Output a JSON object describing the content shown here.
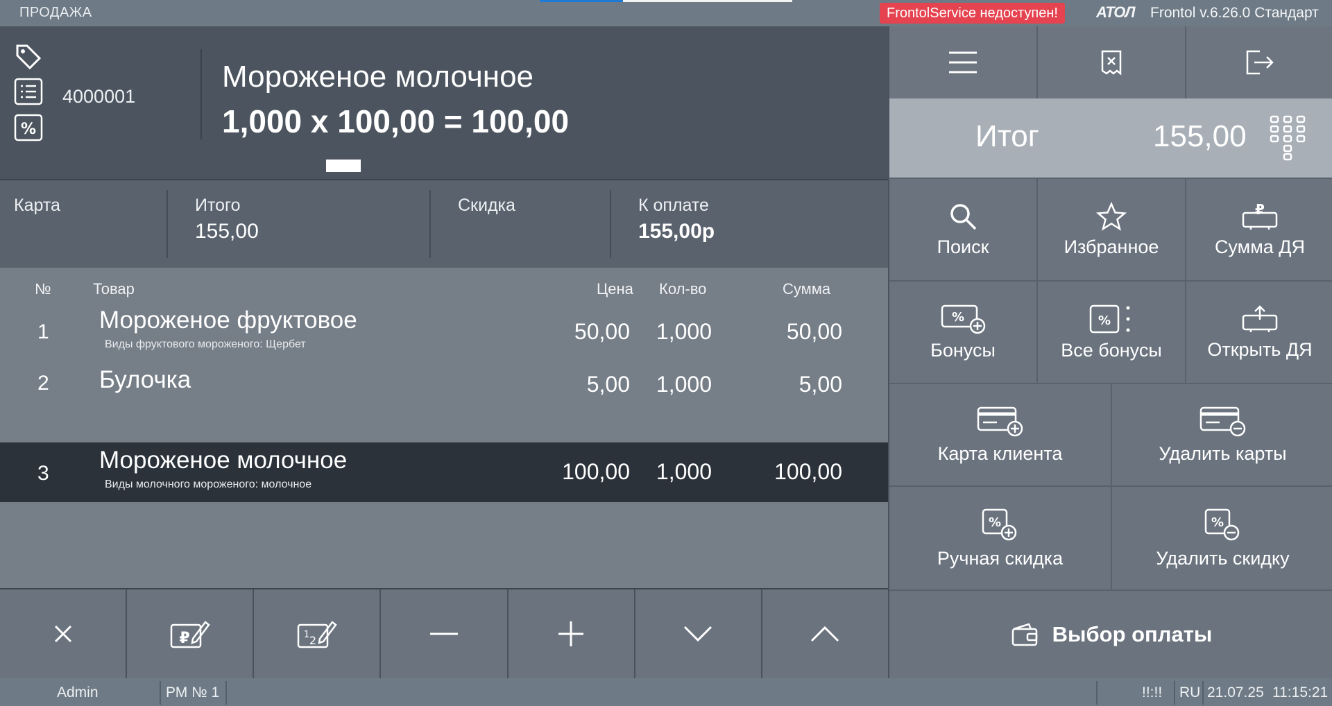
{
  "topbar": {
    "mode": "ПРОДАЖА",
    "progress": 0.33,
    "service_status": "FrontolService недоступен!",
    "brand": "ATOЛ",
    "version": "Frontol v.6.26.0 Стандарт"
  },
  "item_header": {
    "code": "4000001",
    "name": "Мороженое молочное",
    "formula": "1,000 x 100,00 = 100,00",
    "icons": [
      "tag-icon",
      "list-icon",
      "percent-icon"
    ]
  },
  "totals": {
    "card_label": "Карта",
    "card_value": "",
    "itogo_label": "Итого",
    "itogo_value": "155,00",
    "discount_label": "Скидка",
    "discount_value": "",
    "to_pay_label": "К оплате",
    "to_pay_value": "155,00р"
  },
  "table": {
    "headers": {
      "num": "№",
      "name": "Товар",
      "price": "Цена",
      "qty": "Кол-во",
      "sum": "Сумма"
    },
    "rows": [
      {
        "num": "1",
        "name": "Мороженое фруктовое",
        "sub": "Виды фруктового мороженого: Щербет",
        "price": "50,00",
        "qty": "1,000",
        "sum": "50,00"
      },
      {
        "num": "2",
        "name": "Булочка",
        "sub": "",
        "price": "5,00",
        "qty": "1,000",
        "sum": "5,00"
      },
      {
        "num": "3",
        "name": "Мороженое молочное",
        "sub": "Виды молочного мороженого: молочное",
        "price": "100,00",
        "qty": "1,000",
        "sum": "100,00"
      }
    ],
    "selected_row": 3
  },
  "bottom_buttons": [
    "close-icon",
    "edit-price-icon",
    "edit-quantity-icon",
    "minus-icon",
    "plus-icon",
    "chevron-down-icon",
    "chevron-up-icon"
  ],
  "right": {
    "top_buttons": [
      "menu-icon",
      "cancel-receipt-icon",
      "logout-icon"
    ],
    "total_label": "Итог",
    "total_value": "155,00",
    "actions": {
      "search": "Поиск",
      "favorites": "Избранное",
      "sum_dya": "Сумма ДЯ",
      "bonuses": "Бонусы",
      "all_bonuses": "Все бонусы",
      "open_dya": "Открыть ДЯ",
      "client_card": "Карта клиента",
      "delete_cards": "Удалить карты",
      "manual_discount": "Ручная скидка",
      "delete_discount": "Удалить скидку",
      "payment": "Выбор оплаты"
    }
  },
  "statusbar": {
    "user": "Admin",
    "workplace": "РМ № 1",
    "indicator": "!!:!!",
    "lang": "RU",
    "date": "21.07.25",
    "time": "11:15:21"
  },
  "colors": {
    "header_bg": "#4b545f",
    "selected_row": "#2b323a",
    "alert": "#e5434f",
    "total_box": "#a8afb7"
  }
}
